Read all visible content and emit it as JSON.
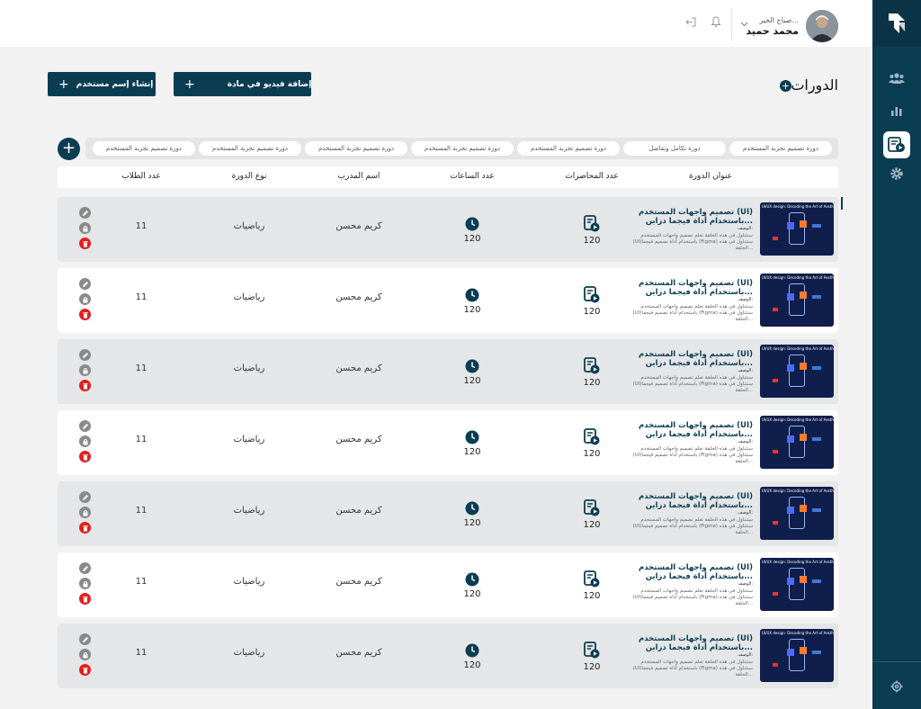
{
  "header": {
    "greeting": "صباح الخير...",
    "user_name": "محمد حميد"
  },
  "page": {
    "title": "الدورات"
  },
  "actions": {
    "add_video_label": "إضافة فيديو في مادة",
    "create_user_label": "إنشاء إسم مستخدم",
    "plus": "+"
  },
  "filters": [
    "دورة تصميم تجربة المستخدم",
    "دورة تكامل وتفاضل",
    "دورة تصميم تجربة المستخدم",
    "دورة تصميم تجربة المستخدم",
    "دورة تصميم تجربة المستخدم",
    "دورة تصميم تجربة المستخدم",
    "دورة تصميم تجربة المستخدم"
  ],
  "table": {
    "columns": {
      "title": "عنوان الدورة",
      "lectures": "عدد المحاضرات",
      "hours": "عدد الساعات",
      "trainer": "اسم المدرب",
      "type": "نوع الدورة",
      "students": "عدد الطلاب"
    },
    "rows": [
      {
        "title": "تصميم واجهات المستخدم (UI) باستخدام أداة فيجما دزاين...",
        "desc_label": "الوصف:",
        "desc": "سنتناول في هذه الحلقة تعلم تصميم واجهات المستخدم (UI)باستخدام أداة تصميم فيجما (Figma) سنتناول في هذه الحلقة...",
        "thumb_caption": "UI/UX design: Decoding the Art of Aesthetic",
        "lectures": "120",
        "hours": "120",
        "trainer": "كريم محسن",
        "type": "رياضيات",
        "students": "11"
      },
      {
        "title": "تصميم واجهات المستخدم (UI) باستخدام أداة فيجما دزاين...",
        "desc_label": "الوصف:",
        "desc": "سنتناول في هذه الحلقة تعلم تصميم واجهات المستخدم (UI)باستخدام أداة تصميم فيجما (Figma) سنتناول في هذه الحلقة...",
        "thumb_caption": "UI/UX design: Decoding the Art of Aesthetic",
        "lectures": "120",
        "hours": "120",
        "trainer": "كريم محسن",
        "type": "رياضيات",
        "students": "11"
      },
      {
        "title": "تصميم واجهات المستخدم (UI) باستخدام أداة فيجما دزاين...",
        "desc_label": "الوصف:",
        "desc": "سنتناول في هذه الحلقة تعلم تصميم واجهات المستخدم (UI)باستخدام أداة تصميم فيجما (Figma) سنتناول في هذه الحلقة...",
        "thumb_caption": "UI/UX design: Decoding the Art of Aesthetic",
        "lectures": "120",
        "hours": "120",
        "trainer": "كريم محسن",
        "type": "رياضيات",
        "students": "11"
      },
      {
        "title": "تصميم واجهات المستخدم (UI) باستخدام أداة فيجما دزاين...",
        "desc_label": "الوصف:",
        "desc": "سنتناول في هذه الحلقة تعلم تصميم واجهات المستخدم (UI)باستخدام أداة تصميم فيجما (Figma) سنتناول في هذه الحلقة...",
        "thumb_caption": "UI/UX design: Decoding the Art of Aesthetic",
        "lectures": "120",
        "hours": "120",
        "trainer": "كريم محسن",
        "type": "رياضيات",
        "students": "11"
      },
      {
        "title": "تصميم واجهات المستخدم (UI) باستخدام أداة فيجما دزاين...",
        "desc_label": "الوصف:",
        "desc": "سنتناول في هذه الحلقة تعلم تصميم واجهات المستخدم (UI)باستخدام أداة تصميم فيجما (Figma) سنتناول في هذه الحلقة...",
        "thumb_caption": "UI/UX design: Decoding the Art of Aesthetic",
        "lectures": "120",
        "hours": "120",
        "trainer": "كريم محسن",
        "type": "رياضيات",
        "students": "11"
      },
      {
        "title": "تصميم واجهات المستخدم (UI) باستخدام أداة فيجما دزاين...",
        "desc_label": "الوصف:",
        "desc": "سنتناول في هذه الحلقة تعلم تصميم واجهات المستخدم (UI)باستخدام أداة تصميم فيجما (Figma) سنتناول في هذه الحلقة...",
        "thumb_caption": "UI/UX design: Decoding the Art of Aesthetic",
        "lectures": "120",
        "hours": "120",
        "trainer": "كريم محسن",
        "type": "رياضيات",
        "students": "11"
      },
      {
        "title": "تصميم واجهات المستخدم (UI) باستخدام أداة فيجما دزاين...",
        "desc_label": "الوصف:",
        "desc": "سنتناول في هذه الحلقة تعلم تصميم واجهات المستخدم (UI)باستخدام أداة تصميم فيجما (Figma) سنتناول في هذه الحلقة...",
        "thumb_caption": "UI/UX design: Decoding the Art of Aesthetic",
        "lectures": "120",
        "hours": "120",
        "trainer": "كريم محسن",
        "type": "رياضيات",
        "students": "11"
      }
    ]
  },
  "icons": {
    "sidebar": [
      "users-icon",
      "bar-chart-icon",
      "course-video-icon",
      "gear-icon",
      "settings-icon"
    ],
    "row_actions": [
      "edit-icon",
      "lock-icon",
      "delete-icon"
    ]
  },
  "colors": {
    "primary": "#0b3d52",
    "danger": "#e61e1e",
    "row_alt": "#e4e6e8"
  }
}
